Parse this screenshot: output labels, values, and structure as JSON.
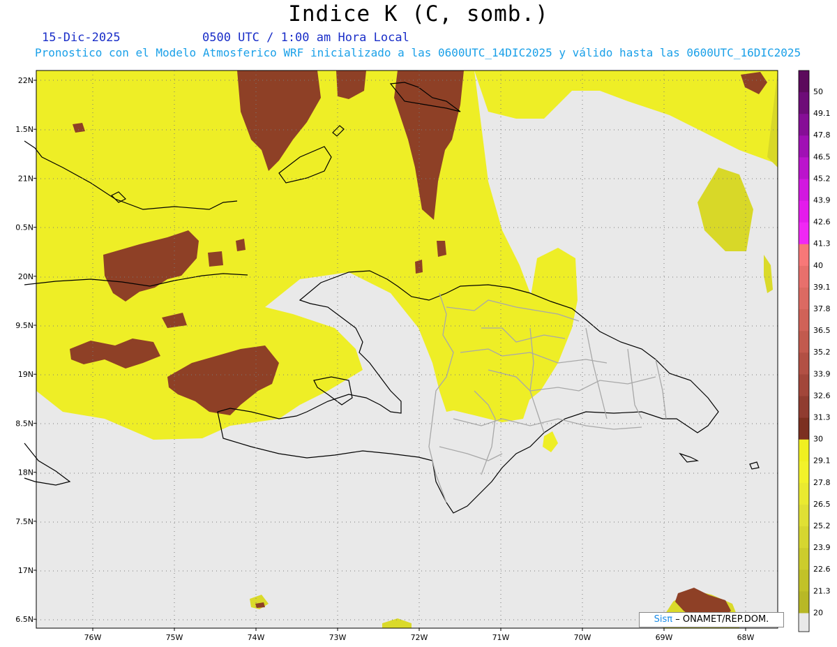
{
  "header": {
    "title": "Indice K (C, somb.)",
    "date": "15-Dic-2025",
    "time": "0500 UTC / 1:00 am Hora Local",
    "subtitle": "Pronostico con el Modelo Atmosferico WRF inicializado a las 0600UTC_14DIC2025 y válido hasta las  0600UTC_16DIC2025"
  },
  "axes": {
    "lat_labels": [
      "22N",
      "1.5N",
      "21N",
      "0.5N",
      "20N",
      "9.5N",
      "19N",
      "8.5N",
      "18N",
      "7.5N",
      "17N",
      "6.5N"
    ],
    "lon_labels": [
      "76W",
      "75W",
      "74W",
      "73W",
      "72W",
      "71W",
      "70W",
      "69W",
      "68W"
    ]
  },
  "colorbar": {
    "ticks": [
      "50",
      "49.1",
      "47.8",
      "46.5",
      "45.2",
      "43.9",
      "42.6",
      "41.3",
      "40",
      "39.1",
      "37.8",
      "36.5",
      "35.2",
      "33.9",
      "32.6",
      "31.3",
      "30",
      "29.1",
      "27.8",
      "26.5",
      "25.2",
      "23.9",
      "22.6",
      "21.3",
      "20"
    ],
    "colors": [
      "#5c0a5c",
      "#6e0c78",
      "#860e96",
      "#a010b4",
      "#bb14cc",
      "#d218e0",
      "#e41cec",
      "#f028f4",
      "#f87878",
      "#e8706c",
      "#dc6a62",
      "#d06258",
      "#c25a4e",
      "#b25044",
      "#a2463a",
      "#903c30",
      "#7c3020",
      "#f0f020",
      "#f2f22a",
      "#eaea30",
      "#e0e034",
      "#d6d630",
      "#cccc2c",
      "#c2c228",
      "#b8b826"
    ]
  },
  "credit": {
    "sis": "Sisπ",
    "text": "– ONAMET/REP.DOM."
  },
  "colors": {
    "background": "#e9e9e9",
    "yellow": "#f0f028",
    "yellow_dark": "#d8d82a",
    "brown": "#8e4026",
    "coast": "#000000",
    "provinces": "#a8a8a8"
  }
}
